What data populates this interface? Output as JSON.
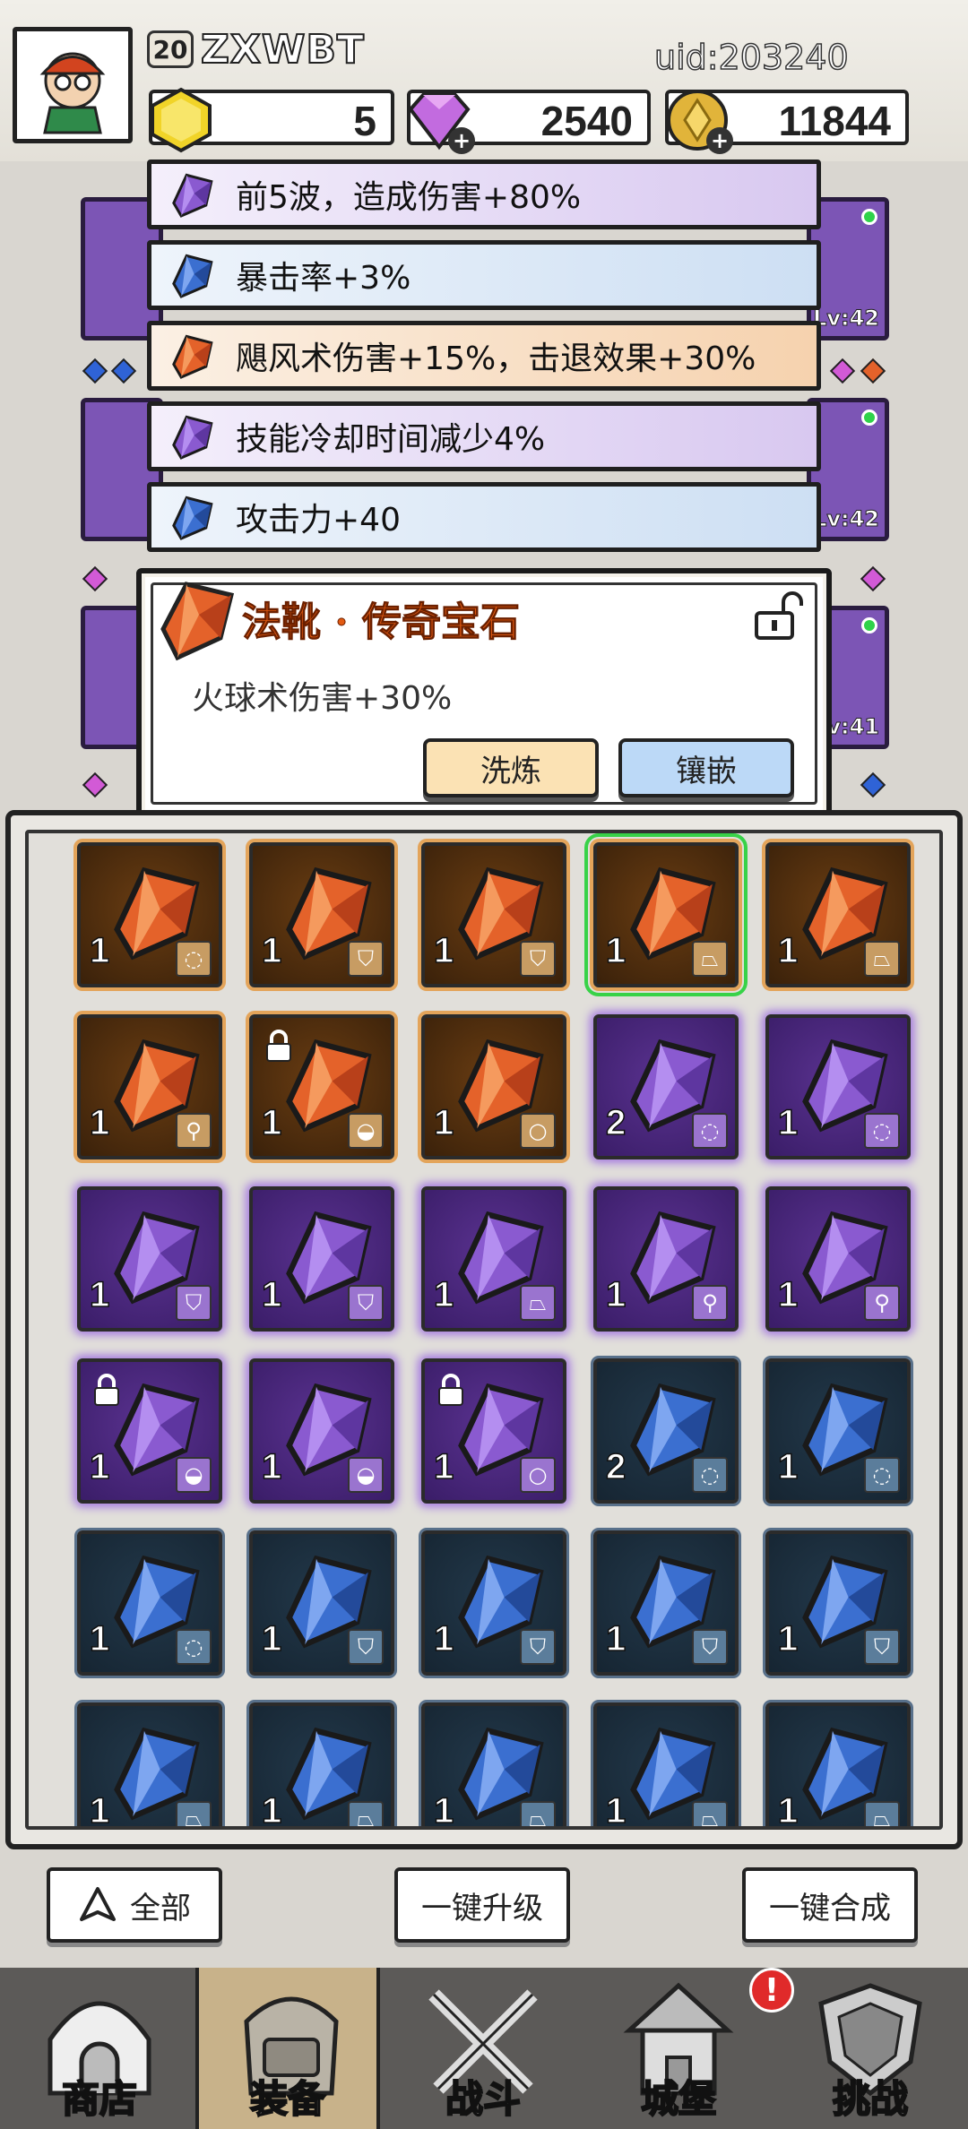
{
  "header": {
    "level": "20",
    "player_name": "ZXWBT",
    "status_text": "uid:203240",
    "resources": [
      {
        "name": "gold-cube",
        "value": "5"
      },
      {
        "name": "gem",
        "value": "2540"
      },
      {
        "name": "coin",
        "value": "11844"
      }
    ]
  },
  "affixes": [
    {
      "text": "前5波，造成伤害+80%",
      "color": "purple"
    },
    {
      "text": "暴击率+3%",
      "color": "blue"
    },
    {
      "text": "飓风术伤害+15%，击退效果+30%",
      "color": "orange"
    },
    {
      "text": "技能冷却时间减少4%",
      "color": "purple"
    },
    {
      "text": "攻击力+40",
      "color": "blue"
    }
  ],
  "equipment_levels": [
    "Lv:42",
    "Lv:42",
    "Lv:41"
  ],
  "detail": {
    "title": "法靴 · 传奇宝石",
    "description": "火球术伤害+30%",
    "refine_label": "洗炼",
    "inlay_label": "镶嵌"
  },
  "inventory": [
    {
      "rarity": "orange",
      "count": "1",
      "type": "ring",
      "locked": false,
      "selected": false
    },
    {
      "rarity": "orange",
      "count": "1",
      "type": "armor",
      "locked": false,
      "selected": false
    },
    {
      "rarity": "orange",
      "count": "1",
      "type": "armor",
      "locked": false,
      "selected": false
    },
    {
      "rarity": "orange",
      "count": "1",
      "type": "boots",
      "locked": false,
      "selected": true
    },
    {
      "rarity": "orange",
      "count": "1",
      "type": "boots",
      "locked": false,
      "selected": false
    },
    {
      "rarity": "orange",
      "count": "1",
      "type": "staff",
      "locked": false,
      "selected": false
    },
    {
      "rarity": "orange",
      "count": "1",
      "type": "hat",
      "locked": true,
      "selected": false
    },
    {
      "rarity": "orange",
      "count": "1",
      "type": "necklace",
      "locked": false,
      "selected": false
    },
    {
      "rarity": "purple",
      "count": "2",
      "type": "ring",
      "locked": false,
      "selected": false
    },
    {
      "rarity": "purple",
      "count": "1",
      "type": "ring",
      "locked": false,
      "selected": false
    },
    {
      "rarity": "purple",
      "count": "1",
      "type": "armor",
      "locked": false,
      "selected": false
    },
    {
      "rarity": "purple",
      "count": "1",
      "type": "armor",
      "locked": false,
      "selected": false
    },
    {
      "rarity": "purple",
      "count": "1",
      "type": "boots",
      "locked": false,
      "selected": false
    },
    {
      "rarity": "purple",
      "count": "1",
      "type": "staff",
      "locked": false,
      "selected": false
    },
    {
      "rarity": "purple",
      "count": "1",
      "type": "staff",
      "locked": false,
      "selected": false
    },
    {
      "rarity": "purple",
      "count": "1",
      "type": "hat",
      "locked": true,
      "selected": false
    },
    {
      "rarity": "purple",
      "count": "1",
      "type": "hat",
      "locked": false,
      "selected": false
    },
    {
      "rarity": "purple",
      "count": "1",
      "type": "necklace",
      "locked": true,
      "selected": false
    },
    {
      "rarity": "blue",
      "count": "2",
      "type": "ring",
      "locked": false,
      "selected": false
    },
    {
      "rarity": "blue",
      "count": "1",
      "type": "ring",
      "locked": false,
      "selected": false
    },
    {
      "rarity": "blue",
      "count": "1",
      "type": "ring",
      "locked": false,
      "selected": false
    },
    {
      "rarity": "blue",
      "count": "1",
      "type": "armor",
      "locked": false,
      "selected": false
    },
    {
      "rarity": "blue",
      "count": "1",
      "type": "armor",
      "locked": false,
      "selected": false
    },
    {
      "rarity": "blue",
      "count": "1",
      "type": "armor",
      "locked": false,
      "selected": false
    },
    {
      "rarity": "blue",
      "count": "1",
      "type": "armor",
      "locked": false,
      "selected": false
    },
    {
      "rarity": "blue",
      "count": "1",
      "type": "boots",
      "locked": false,
      "selected": false
    },
    {
      "rarity": "blue",
      "count": "1",
      "type": "boots",
      "locked": false,
      "selected": false
    },
    {
      "rarity": "blue",
      "count": "1",
      "type": "boots",
      "locked": false,
      "selected": false
    },
    {
      "rarity": "blue",
      "count": "1",
      "type": "boots",
      "locked": false,
      "selected": false
    },
    {
      "rarity": "blue",
      "count": "1",
      "type": "boots",
      "locked": false,
      "selected": false
    }
  ],
  "actions": {
    "filter_label": "全部",
    "upgrade_all_label": "一键升级",
    "merge_all_label": "一键合成"
  },
  "nav": [
    {
      "label": "商店",
      "icon": "shop-icon",
      "active": false
    },
    {
      "label": "装备",
      "icon": "bag-icon",
      "active": true
    },
    {
      "label": "战斗",
      "icon": "swords-icon",
      "active": false
    },
    {
      "label": "城堡",
      "icon": "castle-icon",
      "active": false
    },
    {
      "label": "挑战",
      "icon": "shield-icon",
      "active": false
    }
  ],
  "notification_badge": "!",
  "colors": {
    "orange_gem": "#e4622a",
    "purple_gem": "#8a5ad0",
    "blue_gem": "#3b6fd0",
    "accent_title": "#e25a12"
  }
}
